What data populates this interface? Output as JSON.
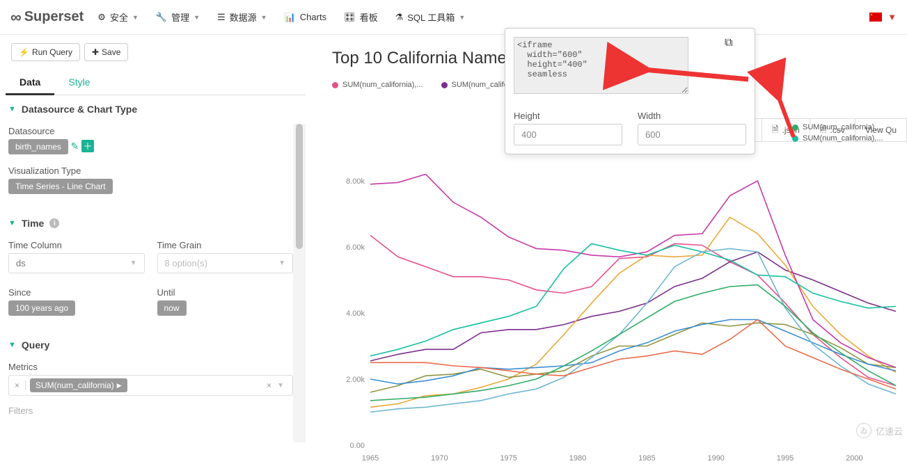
{
  "brand": "Superset",
  "nav": {
    "security": "安全",
    "manage": "管理",
    "datasources": "数据源",
    "charts": "Charts",
    "dashboards": "看板",
    "sql": "SQL 工具箱"
  },
  "toolbar": {
    "run": "Run Query",
    "save": "Save"
  },
  "tabs": {
    "data": "Data",
    "style": "Style"
  },
  "panel": {
    "ds_section": "Datasource & Chart Type",
    "datasource_label": "Datasource",
    "datasource_value": "birth_names",
    "viz_label": "Visualization Type",
    "viz_value": "Time Series - Line Chart",
    "time_section": "Time",
    "time_column_label": "Time Column",
    "time_column_value": "ds",
    "time_grain_label": "Time Grain",
    "time_grain_placeholder": "8 option(s)",
    "since_label": "Since",
    "since_value": "100 years ago",
    "until_label": "Until",
    "until_value": "now",
    "query_section": "Query",
    "metrics_label": "Metrics",
    "metric_chip": "SUM(num_california)",
    "filters_label": "Filters"
  },
  "chart_title": "Top 10 California Name",
  "legend_label": "SUM(num_california),...",
  "popover": {
    "embed_code": "<iframe\n  width=\"600\"\n  height=\"400\"\n  seamless",
    "height_label": "Height",
    "height_value": "400",
    "width_label": "Width",
    "width_value": "600"
  },
  "export": {
    "json": ".json",
    "csv": ".csv",
    "viewq": "View Qu"
  },
  "watermark": "亿速云",
  "colors": {
    "series": [
      "#e6508a",
      "#7a2e8c",
      "#e9a83b",
      "#8f9440",
      "#c73aa8",
      "#18bfa3",
      "#3a8fd1",
      "#6db7d1",
      "#ea6a4c",
      "#2fac66"
    ]
  },
  "chart_data": {
    "type": "line",
    "title": "Top 10 California Name",
    "xlabel": "",
    "ylabel": "",
    "ylim": [
      0,
      8000
    ],
    "xticks": [
      1965,
      1970,
      1975,
      1980,
      1985,
      1990,
      1995,
      2000
    ],
    "yticks": [
      "0.00",
      "2.00k",
      "4.00k",
      "6.00k",
      "8.00k"
    ],
    "x": [
      1965,
      1967,
      1969,
      1971,
      1973,
      1975,
      1977,
      1979,
      1981,
      1983,
      1985,
      1987,
      1989,
      1991,
      1993,
      1995,
      1997,
      1999,
      2001,
      2003
    ],
    "series": [
      {
        "name": "SUM(num_california),...",
        "color": "#e6508a",
        "values": [
          6350,
          5700,
          5400,
          5100,
          5100,
          5000,
          4700,
          4600,
          4800,
          5650,
          5700,
          6100,
          6050,
          5550,
          5150,
          4300,
          3350,
          2650,
          2050,
          1800
        ]
      },
      {
        "name": "SUM(num_california),...",
        "color": "#7a2e8c",
        "values": [
          2550,
          2750,
          2900,
          2900,
          3400,
          3500,
          3500,
          3650,
          3900,
          4050,
          4300,
          4800,
          5050,
          5550,
          5850,
          5300,
          5000,
          4650,
          4300,
          4050
        ]
      },
      {
        "name": "SUM(num_california),...",
        "color": "#e9a83b",
        "values": [
          1150,
          1250,
          1500,
          1550,
          1750,
          2000,
          2450,
          3350,
          4300,
          5200,
          5750,
          5700,
          5750,
          6900,
          6400,
          5450,
          4200,
          3350,
          2700,
          2200
        ]
      },
      {
        "name": "SUM(num_california),...",
        "color": "#8f9440",
        "values": [
          1600,
          1800,
          2100,
          2150,
          2300,
          2050,
          2150,
          2250,
          2700,
          3000,
          3000,
          3350,
          3700,
          3600,
          3700,
          3650,
          3350,
          2950,
          2450,
          2350
        ]
      },
      {
        "name": "SUM(num_california),...",
        "color": "#c73aa8",
        "values": [
          7900,
          7950,
          8200,
          7350,
          6900,
          6300,
          5950,
          5900,
          5750,
          5700,
          5850,
          6350,
          6400,
          7550,
          8000,
          5750,
          3800,
          3100,
          2650,
          2350
        ]
      },
      {
        "name": "SUM(num_california),...",
        "color": "#18bfa3",
        "values": [
          2700,
          2900,
          3150,
          3500,
          3700,
          3900,
          4200,
          5350,
          6100,
          5900,
          5750,
          6050,
          5850,
          5600,
          5150,
          5100,
          4600,
          4350,
          4150,
          4200
        ]
      },
      {
        "name": "SUM(num_california),...",
        "color": "#3a8fd1",
        "values": [
          2000,
          1850,
          1950,
          2100,
          2350,
          2300,
          2350,
          2400,
          2500,
          2850,
          3100,
          3450,
          3650,
          3800,
          3800,
          3450,
          3100,
          2750,
          2450,
          2250
        ]
      },
      {
        "name": "SUM(num_california),...",
        "color": "#6db7d1",
        "values": [
          1000,
          1100,
          1150,
          1250,
          1350,
          1550,
          1700,
          2050,
          2650,
          3350,
          4300,
          5400,
          5850,
          5950,
          5850,
          4150,
          3050,
          2400,
          1850,
          1550
        ]
      },
      {
        "name": "SUM(num_california),...",
        "color": "#ea6a4c",
        "values": [
          2500,
          2500,
          2500,
          2400,
          2350,
          2250,
          2150,
          2100,
          2350,
          2600,
          2700,
          2850,
          2750,
          3200,
          3800,
          3000,
          2650,
          2300,
          2000,
          1700
        ]
      },
      {
        "name": "SUM(num_california),...",
        "color": "#2fac66",
        "values": [
          1350,
          1400,
          1450,
          1550,
          1650,
          1800,
          2000,
          2400,
          2850,
          3350,
          3850,
          4350,
          4600,
          4800,
          4850,
          4200,
          3400,
          2800,
          2250,
          1800
        ]
      }
    ]
  }
}
